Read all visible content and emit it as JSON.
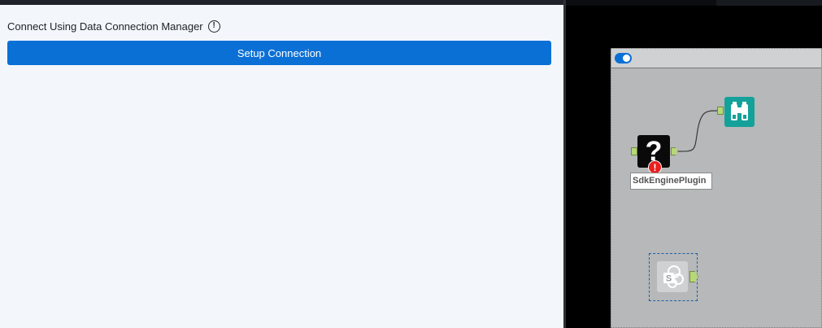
{
  "config_panel": {
    "label": "Connect Using Data Connection Manager",
    "info_icon": "!",
    "setup_button_label": "Setup Connection",
    "accent_color": "#0b70d6"
  },
  "canvas": {
    "container": {
      "toggle": "on"
    },
    "tools": {
      "sdk_plugin": {
        "icon": "?",
        "status_icon": "!",
        "label": "SdkEnginePlugin"
      },
      "browse": {
        "icon": "binoculars-icon"
      },
      "sharepoint": {
        "icon": "sharepoint-icon",
        "glyph": "S"
      }
    }
  }
}
